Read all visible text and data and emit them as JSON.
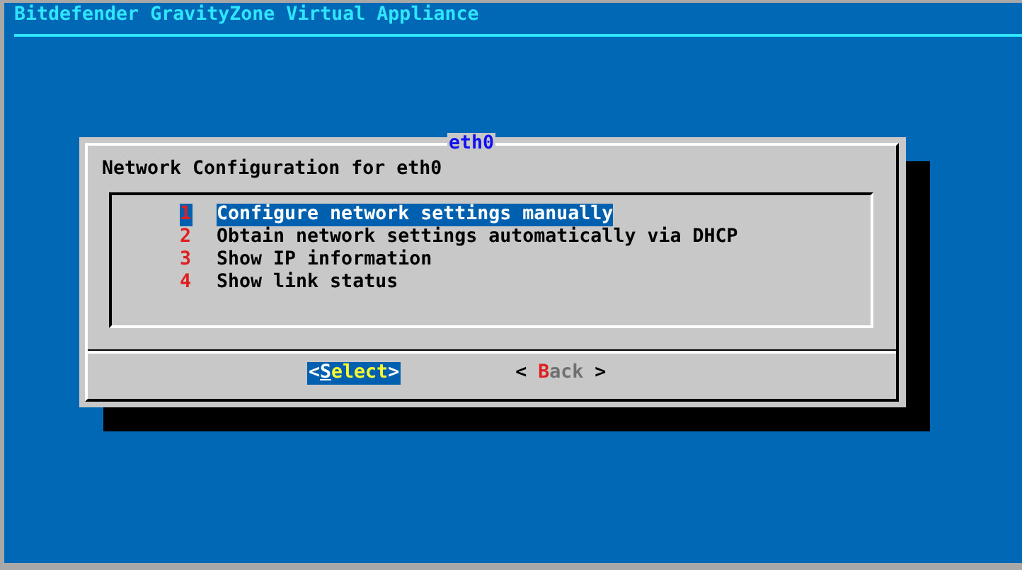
{
  "screen": {
    "title": "Bitdefender GravityZone Virtual Appliance"
  },
  "dialog": {
    "title": "eth0",
    "prompt": "Network Configuration for eth0",
    "menu": [
      {
        "tag": "1",
        "label": "Configure network settings manually",
        "selected": true
      },
      {
        "tag": "2",
        "label": "Obtain network settings automatically via DHCP",
        "selected": false
      },
      {
        "tag": "3",
        "label": "Show IP information",
        "selected": false
      },
      {
        "tag": "4",
        "label": "Show link status",
        "selected": false
      }
    ],
    "buttons": [
      {
        "open": "<",
        "label": "Select",
        "close": ">",
        "selected": true
      },
      {
        "open": "< ",
        "label": "Back",
        "close": " >",
        "selected": false
      }
    ]
  }
}
